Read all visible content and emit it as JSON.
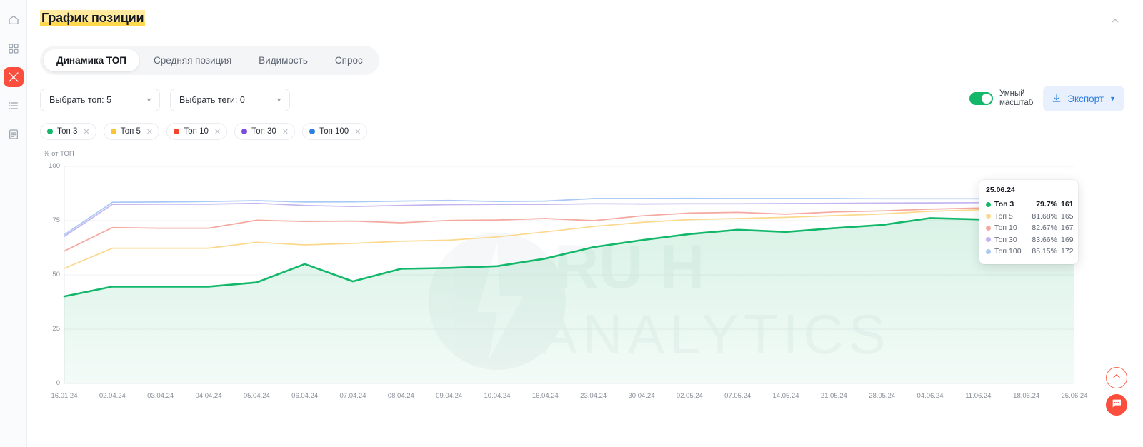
{
  "sidebar": {
    "items": [
      {
        "name": "home",
        "icon": "home-icon",
        "active": false
      },
      {
        "name": "apps",
        "icon": "grid-icon",
        "active": false
      },
      {
        "name": "tools",
        "icon": "tools-icon",
        "active": true
      },
      {
        "name": "list",
        "icon": "list-icon",
        "active": false
      },
      {
        "name": "report",
        "icon": "document-icon",
        "active": false
      }
    ]
  },
  "header": {
    "title": "График позиции",
    "collapse_icon": "chevron-up-icon"
  },
  "tabs": [
    {
      "label": "Динамика ТОП",
      "active": true
    },
    {
      "label": "Средняя позиция",
      "active": false
    },
    {
      "label": "Видимость",
      "active": false
    },
    {
      "label": "Спрос",
      "active": false
    }
  ],
  "filters": [
    {
      "label": "Выбрать топ: 5",
      "icon": "chevron-down-icon"
    },
    {
      "label": "Выбрать теги: 0",
      "icon": "chevron-down-icon"
    }
  ],
  "smart_scale": {
    "label": "Умный\nмасштаб",
    "enabled": true
  },
  "export": {
    "label": "Экспорт",
    "icon": "download-icon",
    "caret": "chevron-down-icon"
  },
  "legend_chips": [
    {
      "label": "Топ 3",
      "color": "#12b76a",
      "remove_icon": "close-icon"
    },
    {
      "label": "Топ 5",
      "color": "#fcc433",
      "remove_icon": "close-icon"
    },
    {
      "label": "Топ 10",
      "color": "#f5452f",
      "remove_icon": "close-icon"
    },
    {
      "label": "Топ 30",
      "color": "#7c4ddb",
      "remove_icon": "close-icon"
    },
    {
      "label": "Топ 100",
      "color": "#2f7fe0",
      "remove_icon": "close-icon"
    }
  ],
  "tooltip": {
    "date": "25.06.24",
    "rows": [
      {
        "label": "Топ 3",
        "percent": "79.7%",
        "count": "161",
        "color": "#12b76a",
        "bold": true
      },
      {
        "label": "Топ 5",
        "percent": "81.68%",
        "count": "165",
        "color": "#fbd88c",
        "bold": false
      },
      {
        "label": "Топ 10",
        "percent": "82.67%",
        "count": "167",
        "color": "#f5a8a0",
        "bold": false
      },
      {
        "label": "Топ 30",
        "percent": "83.66%",
        "count": "169",
        "color": "#c4b5f0",
        "bold": false
      },
      {
        "label": "Топ 100",
        "percent": "85.15%",
        "count": "172",
        "color": "#a8c8f5",
        "bold": false
      }
    ]
  },
  "watermark": {
    "text_top": "RU H",
    "text_bottom": "ANALYTICS"
  },
  "fabs": [
    {
      "name": "scroll-to-top",
      "icon": "chevron-up-icon"
    },
    {
      "name": "chat",
      "icon": "chat-bubble-icon"
    }
  ],
  "chart_data": {
    "type": "line",
    "title": "График позиции",
    "xlabel": "",
    "ylabel": "% от ТОП",
    "ylim": [
      0,
      100
    ],
    "yticks": [
      0,
      25,
      50,
      75,
      100
    ],
    "grid": true,
    "legend_position": "top",
    "x": [
      "16.01.24",
      "02.04.24",
      "03.04.24",
      "04.04.24",
      "05.04.24",
      "06.04.24",
      "07.04.24",
      "08.04.24",
      "09.04.24",
      "10.04.24",
      "16.04.24",
      "23.04.24",
      "30.04.24",
      "02.05.24",
      "07.05.24",
      "14.05.24",
      "21.05.24",
      "28.05.24",
      "04.06.24",
      "11.06.24",
      "18.06.24",
      "25.06.24"
    ],
    "series": [
      {
        "name": "Топ 3",
        "color": "#12b76a",
        "filled": true,
        "values": [
          40.1,
          44.6,
          44.6,
          44.6,
          46.5,
          55.0,
          47.0,
          52.8,
          53.2,
          54.0,
          57.5,
          62.8,
          66.0,
          68.8,
          70.8,
          69.8,
          71.5,
          73.0,
          76.2,
          75.6,
          77.5,
          79.7
        ]
      },
      {
        "name": "Топ 5",
        "color": "#fbd88c",
        "filled": false,
        "values": [
          53.0,
          62.3,
          62.3,
          62.3,
          65.0,
          63.8,
          64.5,
          65.5,
          66.0,
          67.5,
          69.8,
          72.3,
          74.2,
          75.5,
          76.0,
          76.5,
          77.3,
          78.1,
          79.3,
          80.0,
          80.8,
          81.68
        ]
      },
      {
        "name": "Топ 10",
        "color": "#f5a8a0",
        "filled": false,
        "values": [
          61.0,
          71.8,
          71.5,
          71.5,
          75.2,
          74.6,
          74.8,
          74.0,
          75.1,
          75.3,
          76.0,
          75.0,
          77.2,
          78.5,
          78.8,
          78.0,
          79.0,
          79.5,
          80.3,
          80.8,
          81.5,
          82.67
        ]
      },
      {
        "name": "Топ 30",
        "color": "#c4b5f0",
        "filled": false,
        "values": [
          67.7,
          82.5,
          82.6,
          82.6,
          83.0,
          82.0,
          81.5,
          82.0,
          82.4,
          82.5,
          82.5,
          82.8,
          82.7,
          82.8,
          82.8,
          82.9,
          83.0,
          83.1,
          83.2,
          83.3,
          83.5,
          83.66
        ]
      },
      {
        "name": "Топ 100",
        "color": "#a8c8f5",
        "filled": false,
        "values": [
          68.5,
          83.5,
          83.6,
          83.8,
          84.2,
          83.6,
          83.7,
          84.0,
          84.3,
          83.8,
          84.0,
          85.2,
          85.2,
          85.3,
          85.2,
          85.2,
          85.2,
          85.1,
          85.1,
          85.1,
          85.1,
          85.15
        ]
      }
    ]
  }
}
